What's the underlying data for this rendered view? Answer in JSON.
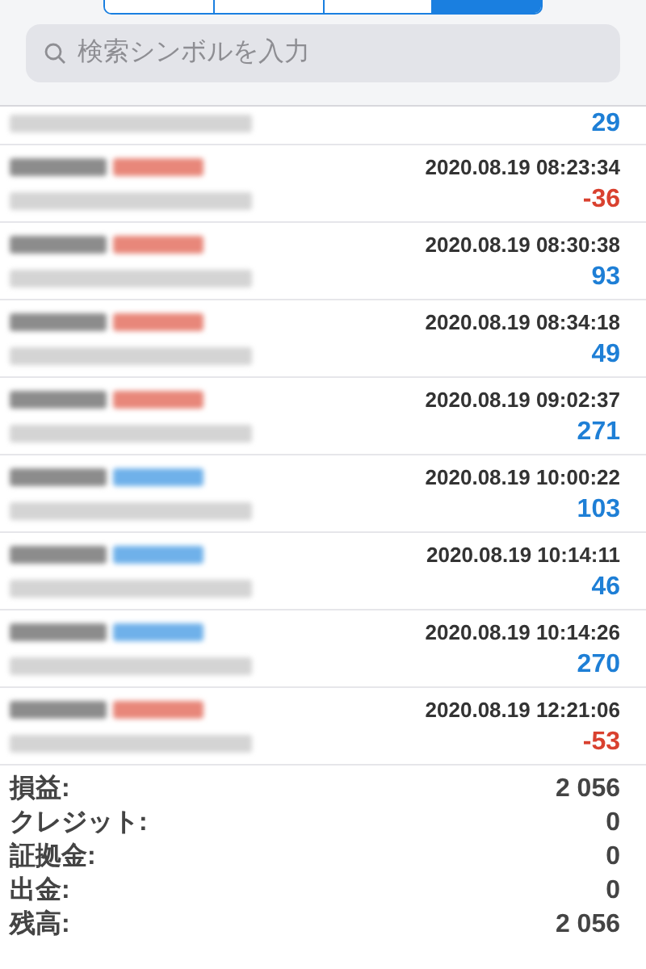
{
  "segments": [
    {
      "selected": false
    },
    {
      "selected": false
    },
    {
      "selected": false
    },
    {
      "selected": true
    }
  ],
  "search": {
    "placeholder": "検索シンボルを入力"
  },
  "deals": [
    {
      "profit": "29",
      "loss": false
    },
    {
      "color": "#e8877a",
      "time": "2020.08.19 08:23:34",
      "profit": "-36",
      "loss": true
    },
    {
      "color": "#e8877a",
      "time": "2020.08.19 08:30:38",
      "profit": "93",
      "loss": false
    },
    {
      "color": "#e8877a",
      "time": "2020.08.19 08:34:18",
      "profit": "49",
      "loss": false
    },
    {
      "color": "#e8877a",
      "time": "2020.08.19 09:02:37",
      "profit": "271",
      "loss": false
    },
    {
      "color": "#6fb1ea",
      "time": "2020.08.19 10:00:22",
      "profit": "103",
      "loss": false
    },
    {
      "color": "#6fb1ea",
      "time": "2020.08.19 10:14:11",
      "profit": "46",
      "loss": false
    },
    {
      "color": "#6fb1ea",
      "time": "2020.08.19 10:14:26",
      "profit": "270",
      "loss": false
    },
    {
      "color": "#e8877a",
      "time": "2020.08.19 12:21:06",
      "profit": "-53",
      "loss": true
    }
  ],
  "summary": [
    {
      "label": "損益:",
      "value": "2 056"
    },
    {
      "label": "クレジット:",
      "value": "0"
    },
    {
      "label": "証拠金:",
      "value": "0"
    },
    {
      "label": "出金:",
      "value": "0"
    },
    {
      "label": "残高:",
      "value": "2 056"
    }
  ]
}
